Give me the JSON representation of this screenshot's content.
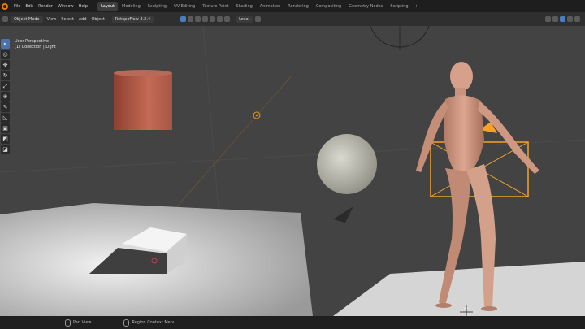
{
  "app": {
    "name": "Blender"
  },
  "topbar": {
    "menus": [
      "File",
      "Edit",
      "Render",
      "Window",
      "Help"
    ],
    "workspaces": [
      "Layout",
      "Modeling",
      "Sculpting",
      "UV Editing",
      "Texture Paint",
      "Shading",
      "Animation",
      "Rendering",
      "Compositing",
      "Geometry Nodes",
      "Scripting"
    ],
    "active_workspace": "Layout",
    "add_tab": "+"
  },
  "header": {
    "mode": "Object Mode",
    "menus": [
      "View",
      "Select",
      "Add",
      "Object"
    ],
    "rendering_label": "RetopoFlow 3.2.4",
    "transform_orientation": "Local"
  },
  "viewport": {
    "view_name": "User Perspective",
    "collection_label": "(1) Collection | Light"
  },
  "tools": [
    "select-box",
    "cursor",
    "move",
    "rotate",
    "scale",
    "transform",
    "annotate",
    "measure",
    "add-cube",
    "extrude",
    "inset"
  ],
  "statusbar": {
    "items": [
      {
        "icon": "mouse-left-icon",
        "label": "Pan View"
      },
      {
        "icon": "mouse-right-icon",
        "label": "Region Context Menu"
      }
    ]
  },
  "colors": {
    "accent": "#e87d0d",
    "selection": "#f5a12a",
    "viewport_bg": "#434343",
    "active_tab": "#3d3d3d"
  }
}
